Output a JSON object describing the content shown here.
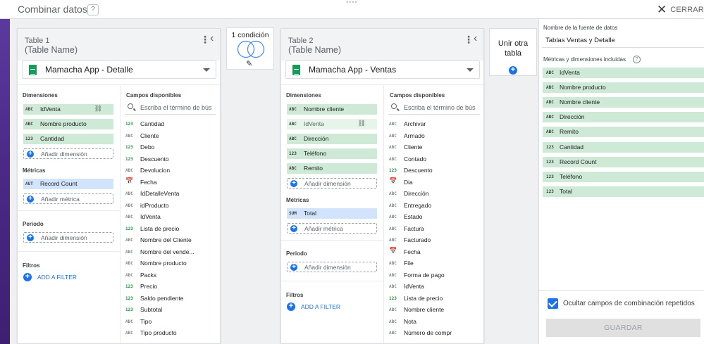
{
  "header": {
    "title": "Combinar datos",
    "help_label": "?",
    "drag_handle": "••••",
    "close_label": "CERRAR"
  },
  "table1": {
    "name": "Table 1",
    "placeholder_name": "(Table Name)",
    "source": "Mamacha App - Detalle",
    "dimensions_title": "Dimensiones",
    "dimensions": [
      {
        "type": "ABC",
        "label": "IdVenta"
      },
      {
        "type": "ABC",
        "label": "Nombre producto"
      },
      {
        "type": "123",
        "label": "Cantidad"
      }
    ],
    "add_dimension": "Añadir dimensión",
    "metrics_title": "Métricas",
    "metrics": [
      {
        "type": "AUT",
        "label": "Record Count"
      }
    ],
    "add_metric": "Añadir métrica",
    "period_title": "Periodo",
    "add_period_dimension": "Añadir dimensión",
    "filters_title": "Filtros",
    "add_filter": "ADD A FILTER",
    "fields_title": "Campos disponibles",
    "search_placeholder": "Escriba el término de bús",
    "fields": [
      {
        "type": "123",
        "label": "Cantidad"
      },
      {
        "type": "ABC",
        "label": "Cliente"
      },
      {
        "type": "123",
        "label": "Debo"
      },
      {
        "type": "123",
        "label": "Descuento"
      },
      {
        "type": "ABC",
        "label": "Devolucion"
      },
      {
        "type": "CAL",
        "label": "Fecha"
      },
      {
        "type": "ABC",
        "label": "IdDetalleVenta"
      },
      {
        "type": "ABC",
        "label": "idProducto"
      },
      {
        "type": "ABC",
        "label": "IdVenta"
      },
      {
        "type": "123",
        "label": "Lista de precio"
      },
      {
        "type": "ABC",
        "label": "Nombre del Cliente"
      },
      {
        "type": "ABC",
        "label": "Nombre del vende..."
      },
      {
        "type": "ABC",
        "label": "Nombre producto"
      },
      {
        "type": "ABC",
        "label": "Packs"
      },
      {
        "type": "123",
        "label": "Precio"
      },
      {
        "type": "123",
        "label": "Saldo pendiente"
      },
      {
        "type": "123",
        "label": "Subtotal"
      },
      {
        "type": "ABC",
        "label": "Tipo"
      },
      {
        "type": "ABC",
        "label": "Tipo producto"
      }
    ]
  },
  "join": {
    "label": "1 condición"
  },
  "table2": {
    "name": "Table 2",
    "placeholder_name": "(Table Name)",
    "source": "Mamacha App - Ventas",
    "dimensions_title": "Dimensiones",
    "dimensions": [
      {
        "type": "ABC",
        "label": "Nombre cliente"
      },
      {
        "type": "ABC",
        "label": "IdVenta"
      },
      {
        "type": "ABC",
        "label": "Dirección"
      },
      {
        "type": "123",
        "label": "Teléfono"
      },
      {
        "type": "ABC",
        "label": "Remito"
      }
    ],
    "add_dimension": "Añadir dimensión",
    "metrics_title": "Métricas",
    "metrics": [
      {
        "type": "SUM",
        "label": "Total"
      }
    ],
    "add_metric": "Añadir métrica",
    "period_title": "Periodo",
    "add_period_dimension": "Añadir dimensión",
    "filters_title": "Filtros",
    "add_filter": "ADD A FILTER",
    "fields_title": "Campos disponibles",
    "search_placeholder": "Escriba el término de bús",
    "fields": [
      {
        "type": "ABC",
        "label": "Archivar"
      },
      {
        "type": "ABC",
        "label": "Armado"
      },
      {
        "type": "ABC",
        "label": "Cliente"
      },
      {
        "type": "ABC",
        "label": "Contado"
      },
      {
        "type": "123",
        "label": "Descuento"
      },
      {
        "type": "CAL",
        "label": "Dia"
      },
      {
        "type": "ABC",
        "label": "Dirección"
      },
      {
        "type": "ABC",
        "label": "Entregado"
      },
      {
        "type": "ABC",
        "label": "Estado"
      },
      {
        "type": "ABC",
        "label": "Factura"
      },
      {
        "type": "ABC",
        "label": "Facturado"
      },
      {
        "type": "CAL",
        "label": "Fecha"
      },
      {
        "type": "ABC",
        "label": "File"
      },
      {
        "type": "ABC",
        "label": "Forma de pago"
      },
      {
        "type": "ABC",
        "label": "IdVenta"
      },
      {
        "type": "123",
        "label": "Lista de precio"
      },
      {
        "type": "ABC",
        "label": "Nombre cliente"
      },
      {
        "type": "ABC",
        "label": "Nota"
      },
      {
        "type": "ABC",
        "label": "Número de compr"
      }
    ]
  },
  "add_table": {
    "label_line1": "Unir otra",
    "label_line2": "tabla"
  },
  "right_panel": {
    "datasource_label": "Nombre de la fuente de datos",
    "datasource_name": "Tablas Ventas y Detalle",
    "included_label": "Métricas y dimensiones incluidas",
    "included": [
      {
        "type": "ABC",
        "label": "IdVenta"
      },
      {
        "type": "ABC",
        "label": "Nombre producto"
      },
      {
        "type": "ABC",
        "label": "Nombre cliente"
      },
      {
        "type": "ABC",
        "label": "Dirección"
      },
      {
        "type": "ABC",
        "label": "Remito"
      },
      {
        "type": "123",
        "label": "Cantidad"
      },
      {
        "type": "123",
        "label": "Record Count"
      },
      {
        "type": "123",
        "label": "Teléfono"
      },
      {
        "type": "123",
        "label": "Total"
      }
    ],
    "hide_repeated_label": "Ocultar campos de combinación repetidos",
    "hide_repeated_checked": true,
    "save_label": "GUARDAR"
  },
  "colors": {
    "dimension_chip": "#ceead6",
    "metric_chip": "#d2e3fc",
    "accent": "#1a73e8",
    "sheets_green": "#0f9d58"
  }
}
